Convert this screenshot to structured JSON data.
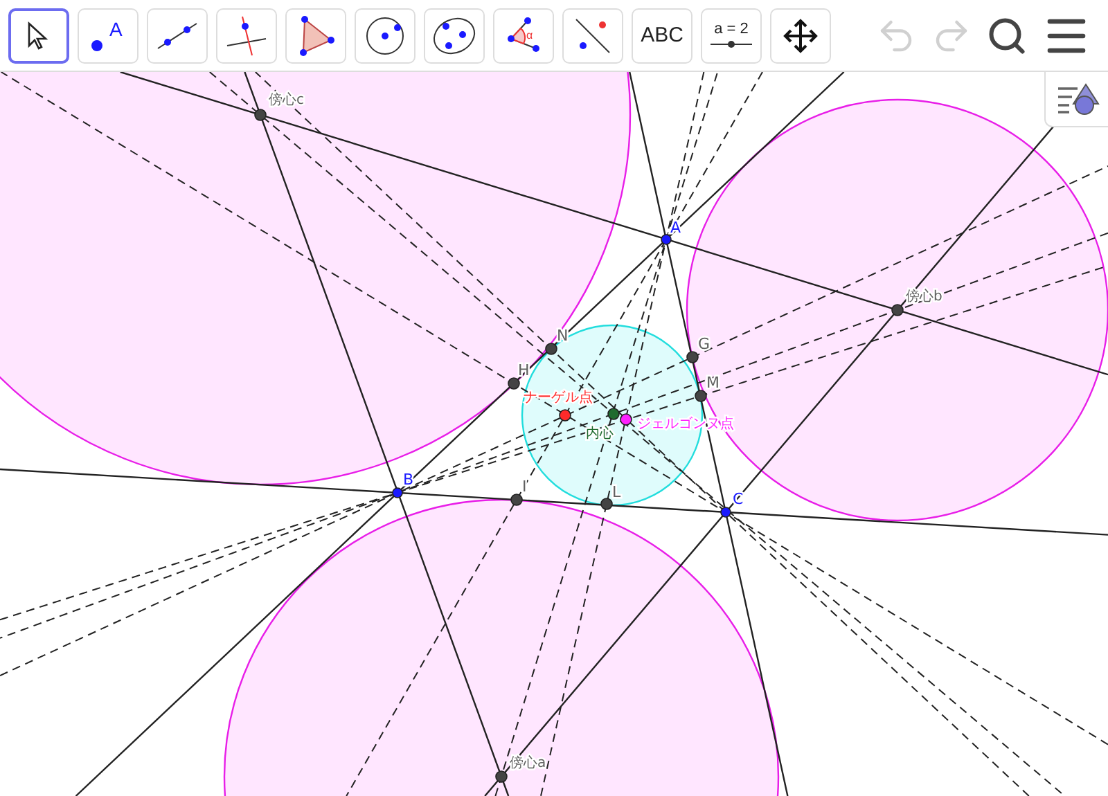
{
  "toolbar": {
    "tools": [
      {
        "kind": "move",
        "selected": true
      },
      {
        "kind": "point",
        "selected": false,
        "label": "A"
      },
      {
        "kind": "line",
        "selected": false
      },
      {
        "kind": "perpendicular",
        "selected": false
      },
      {
        "kind": "polygon",
        "selected": false
      },
      {
        "kind": "circle",
        "selected": false
      },
      {
        "kind": "conic",
        "selected": false
      },
      {
        "kind": "angle",
        "selected": false,
        "label": "α"
      },
      {
        "kind": "reflect",
        "selected": false
      },
      {
        "kind": "text",
        "selected": false,
        "label": "ABC"
      },
      {
        "kind": "slider",
        "selected": false,
        "label": "a = 2"
      },
      {
        "kind": "pan",
        "selected": false
      }
    ],
    "undo": {
      "disabled": true
    },
    "redo": {
      "disabled": true
    }
  },
  "points": [
    {
      "kind": "vertex",
      "label": "A",
      "color": "#1a1aff"
    },
    {
      "kind": "vertex",
      "label": "B",
      "color": "#1a1aff"
    },
    {
      "kind": "vertex",
      "label": "C",
      "color": "#1a1aff"
    },
    {
      "kind": "excenter",
      "label": "傍心c",
      "color": "#606060"
    },
    {
      "kind": "excenter",
      "label": "傍心b",
      "color": "#606060"
    },
    {
      "kind": "excenter",
      "label": "傍心a",
      "color": "#606060"
    },
    {
      "kind": "touch",
      "label": "G",
      "color": "#606060"
    },
    {
      "kind": "touch",
      "label": "M",
      "color": "#606060"
    },
    {
      "kind": "touch",
      "label": "N",
      "color": "#606060"
    },
    {
      "kind": "touch",
      "label": "H",
      "color": "#606060"
    },
    {
      "kind": "touch",
      "label": "I",
      "color": "#606060"
    },
    {
      "kind": "touch",
      "label": "L",
      "color": "#606060"
    },
    {
      "kind": "center",
      "label": "ナーゲル点",
      "color": "#ff2a2a"
    },
    {
      "kind": "center",
      "label": "内心",
      "color": "#1f6b2e"
    },
    {
      "kind": "center",
      "label": "ジェルゴンヌ点",
      "color": "#ff22ff"
    }
  ]
}
